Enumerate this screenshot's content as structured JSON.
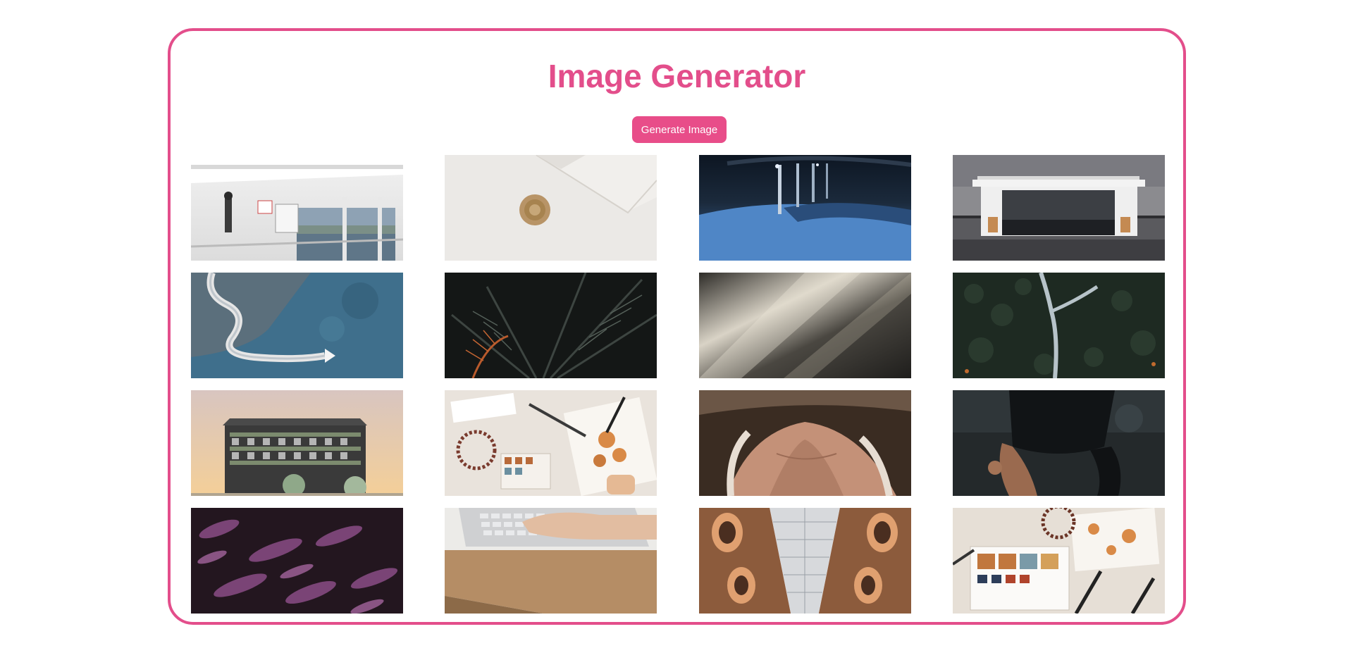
{
  "app": {
    "title": "Image Generator",
    "accent_color": "#e34e8b",
    "button_color": "#e84d89"
  },
  "controls": {
    "generate_label": "Generate Image"
  },
  "gallery": {
    "images": [
      {
        "subject": "ferry-deck-photo"
      },
      {
        "subject": "wax-seal-envelope-photo"
      },
      {
        "subject": "night-walkway-photo"
      },
      {
        "subject": "seaside-shelter-photo"
      },
      {
        "subject": "coastal-road-aerial-photo"
      },
      {
        "subject": "palm-leaves-photo"
      },
      {
        "subject": "light-rays-photo"
      },
      {
        "subject": "forest-river-aerial-photo"
      },
      {
        "subject": "building-facade-photo"
      },
      {
        "subject": "watercolor-painting-photo"
      },
      {
        "subject": "shoulder-portrait-photo"
      },
      {
        "subject": "dark-dress-photo"
      },
      {
        "subject": "purple-flowers-blur-photo"
      },
      {
        "subject": "laptop-typing-photo"
      },
      {
        "subject": "arcade-ceiling-photo"
      },
      {
        "subject": "paint-palette-photo"
      }
    ]
  }
}
